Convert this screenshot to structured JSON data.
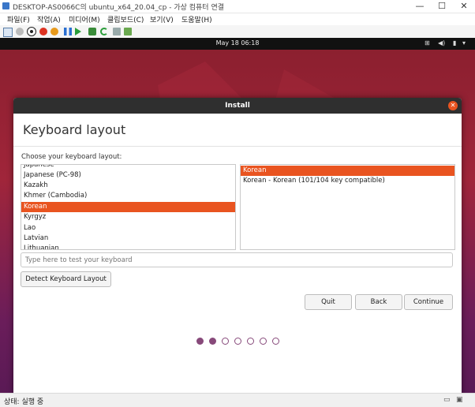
{
  "window": {
    "title": "DESKTOP-AS0066C의 ubuntu_x64_20.04_cp - 가상 컴퓨터 연결",
    "minimize_glyph": "—",
    "maximize_glyph": "☐",
    "close_glyph": "✕"
  },
  "menu": [
    "파일(F)",
    "작업(A)",
    "미디어(M)",
    "클립보드(C)",
    "보기(V)",
    "도움말(H)"
  ],
  "ubuntu": {
    "clock": "May 18  06:18"
  },
  "dialog": {
    "title": "Install",
    "page_title": "Keyboard layout",
    "choose_label": "Choose your keyboard layout:",
    "layouts": [
      "Japanese",
      "Japanese (PC-98)",
      "Kazakh",
      "Khmer (Cambodia)",
      "Korean",
      "Kyrgyz",
      "Lao",
      "Latvian",
      "Lithuanian"
    ],
    "selected_layout": "Korean",
    "variants": [
      "Korean",
      "Korean - Korean (101/104 key compatible)"
    ],
    "selected_variant": "Korean",
    "test_placeholder": "Type here to test your keyboard",
    "detect_label": "Detect Keyboard Layout",
    "quit_label": "Quit",
    "back_label": "Back",
    "continue_label": "Continue",
    "progress": {
      "current_step": 2,
      "total_steps": 7
    }
  },
  "status": {
    "text": "상태: 실행 중"
  },
  "colors": {
    "accent": "#e95420",
    "dot": "#87497a",
    "titlebar": "#2f2f2f"
  }
}
